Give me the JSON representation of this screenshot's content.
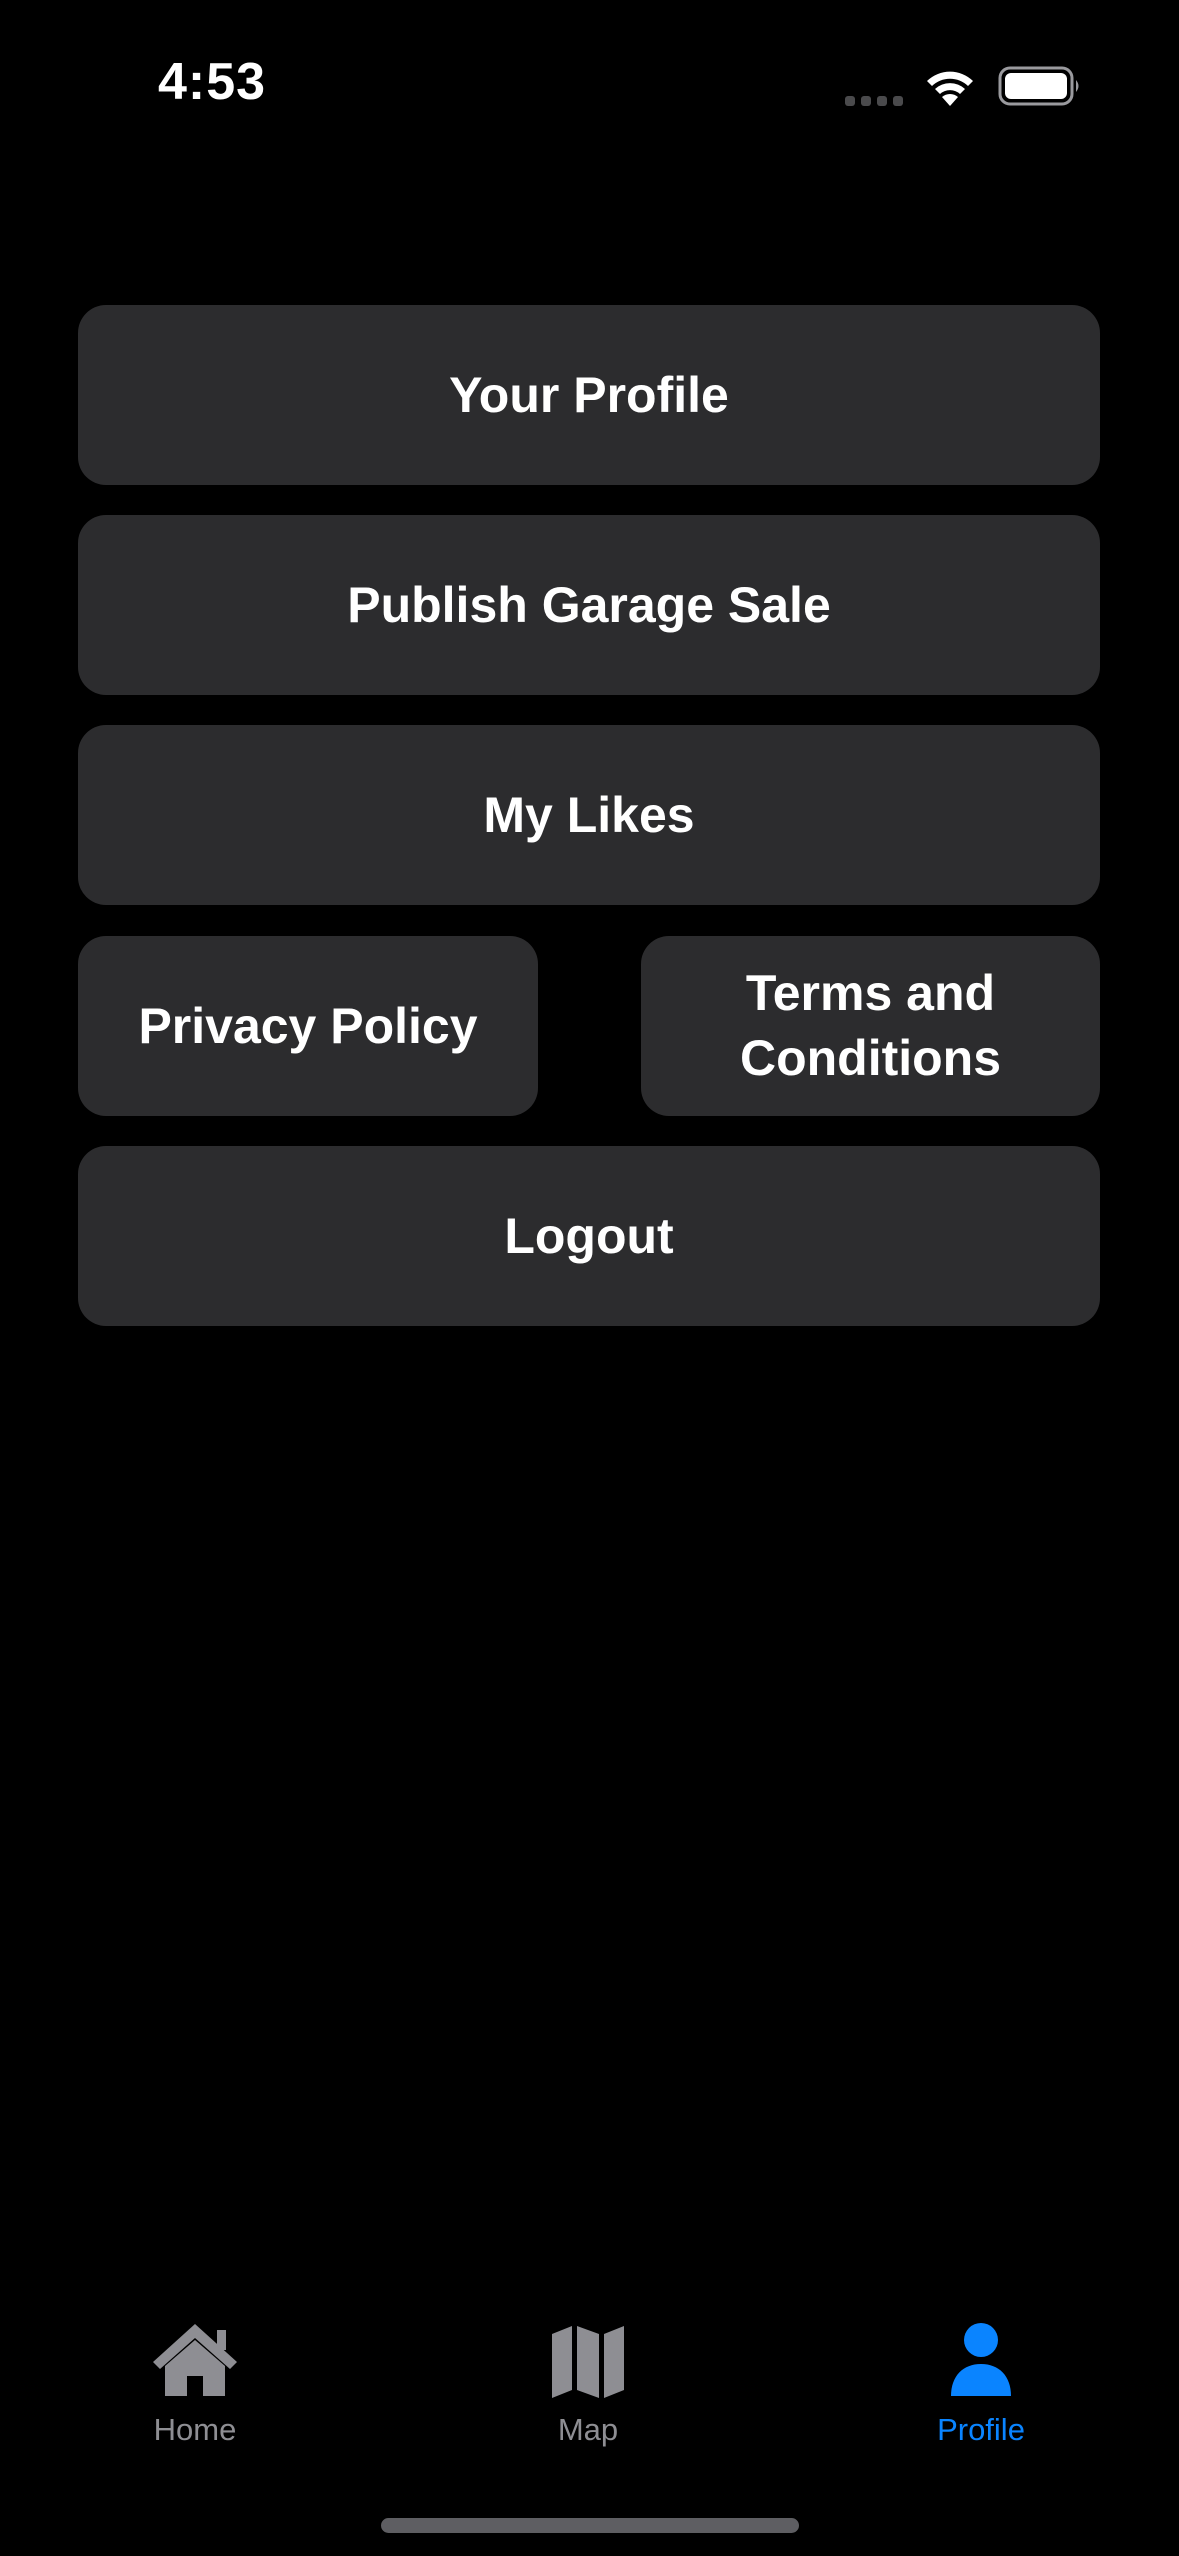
{
  "status_bar": {
    "time": "4:53"
  },
  "menu": {
    "your_profile": "Your Profile",
    "publish_garage_sale": "Publish Garage Sale",
    "my_likes": "My Likes",
    "privacy_policy": "Privacy Policy",
    "terms_and_conditions": "Terms and Conditions",
    "logout": "Logout"
  },
  "tab_bar": {
    "home": {
      "label": "Home",
      "icon": "house-icon"
    },
    "map": {
      "label": "Map",
      "icon": "map-icon"
    },
    "profile": {
      "label": "Profile",
      "icon": "person-icon",
      "selected": true
    }
  },
  "colors": {
    "background": "#000000",
    "button_background": "#2c2c2e",
    "accent": "#0a84ff",
    "inactive_tab": "#8e8e93"
  }
}
